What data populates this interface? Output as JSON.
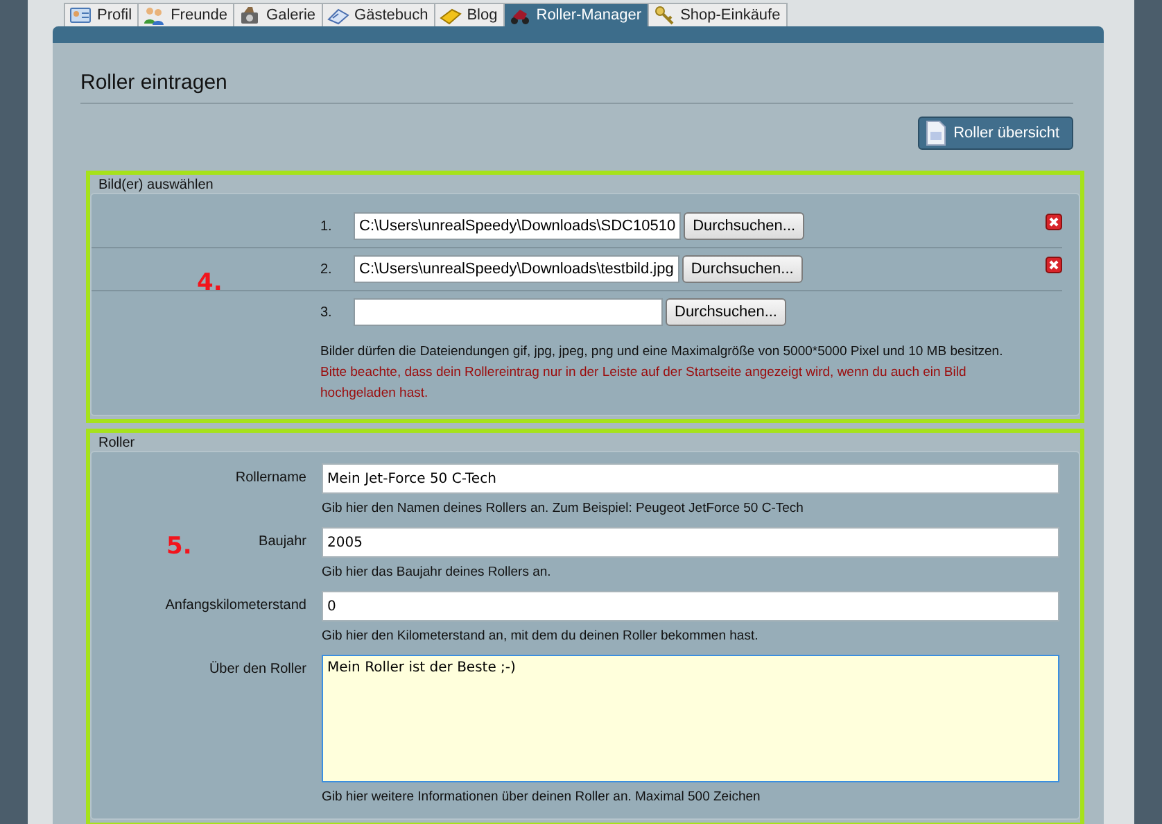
{
  "tabs": [
    {
      "label": "Profil",
      "selected": false
    },
    {
      "label": "Freunde",
      "selected": false
    },
    {
      "label": "Galerie",
      "selected": false
    },
    {
      "label": "Gästebuch",
      "selected": false
    },
    {
      "label": "Blog",
      "selected": false
    },
    {
      "label": "Roller-Manager",
      "selected": true
    },
    {
      "label": "Shop-Einkäufe",
      "selected": false
    }
  ],
  "page_title": "Roller eintragen",
  "overview_button": "Roller übersicht",
  "image_section": {
    "legend": "Bild(er) auswählen",
    "marker": "4.",
    "files": [
      {
        "number": "1.",
        "value": "C:\\Users\\unrealSpeedy\\Downloads\\SDC10510",
        "button": "Durchsuchen...",
        "removable": true
      },
      {
        "number": "2.",
        "value": "C:\\Users\\unrealSpeedy\\Downloads\\testbild.jpg",
        "button": "Durchsuchen...",
        "removable": true
      },
      {
        "number": "3.",
        "button": "Durchsuchen...",
        "removable": false
      }
    ],
    "info": "Bilder dürfen die Dateiendungen gif, jpg, jpeg, png und eine Maximalgröße von 5000*5000 Pixel und 10 MB besitzen.",
    "warning": "Bitte beachte, dass dein Rollereintrag nur in der Leiste auf der Startseite angezeigt wird, wenn du auch ein Bild hochgeladen hast."
  },
  "roller_section": {
    "legend": "Roller",
    "marker": "5.",
    "fields": [
      {
        "label": "Rollername",
        "kind": "text",
        "value": "Mein Jet-Force 50 C-Tech",
        "hint": "Gib hier den Namen deines Rollers an. Zum Beispiel: Peugeot JetForce 50 C-Tech",
        "focused": false
      },
      {
        "label": "Baujahr",
        "kind": "text",
        "value": "2005",
        "hint": "Gib hier das Baujahr deines Rollers an.",
        "focused": false
      },
      {
        "label": "Anfangskilometerstand",
        "kind": "text",
        "value": "0",
        "hint": "Gib hier den Kilometerstand an, mit dem du deinen Roller bekommen hast.",
        "focused": false
      },
      {
        "label": "Über den Roller",
        "kind": "textarea",
        "value": "Mein Roller ist der Beste ;-)",
        "hint": "Gib hier weitere Informationen über deinen Roller an. Maximal 500 Zeichen",
        "focused": true
      }
    ]
  }
}
